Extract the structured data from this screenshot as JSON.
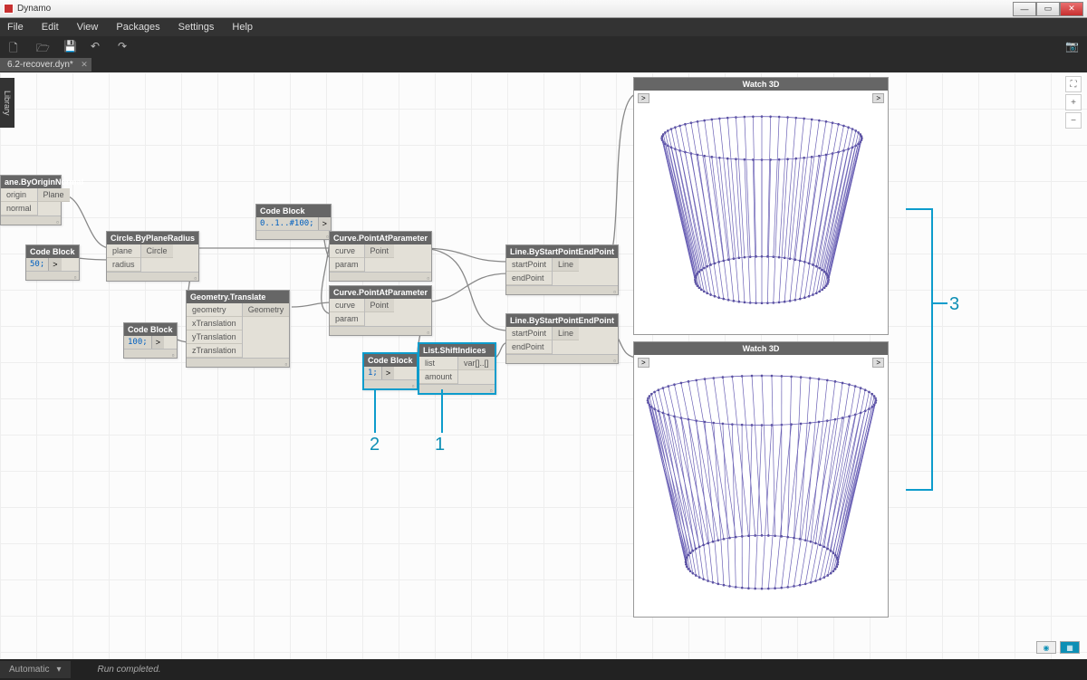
{
  "app_title": "Dynamo",
  "menu": [
    "File",
    "Edit",
    "View",
    "Packages",
    "Settings",
    "Help"
  ],
  "tab_name": "6.2-recover.dyn*",
  "library_label": "Library",
  "run_mode": "Automatic",
  "run_msg": "Run completed.",
  "annotations": {
    "a1": "1",
    "a2": "2",
    "a3": "3"
  },
  "nodes": {
    "planeByOriginNormal": {
      "title": "ane.ByOriginNormal",
      "inputs": [
        "origin",
        "normal"
      ],
      "outputs": [
        "Plane"
      ]
    },
    "codeBlock50": {
      "title": "Code Block",
      "code": "50;",
      "out": ">"
    },
    "codeBlock100": {
      "title": "Code Block",
      "code": "100;",
      "out": ">"
    },
    "codeBlockRange": {
      "title": "Code Block",
      "code": "0..1..#100;",
      "out": ">"
    },
    "codeBlock1": {
      "title": "Code Block",
      "code": "1;",
      "out": ">"
    },
    "circleByPlaneRadius": {
      "title": "Circle.ByPlaneRadius",
      "inputs": [
        "plane",
        "radius"
      ],
      "outputs": [
        "Circle"
      ]
    },
    "geometryTranslate": {
      "title": "Geometry.Translate",
      "inputs": [
        "geometry",
        "xTranslation",
        "yTranslation",
        "zTranslation"
      ],
      "outputs": [
        "Geometry"
      ]
    },
    "curvePointAtParam1": {
      "title": "Curve.PointAtParameter",
      "inputs": [
        "curve",
        "param"
      ],
      "outputs": [
        "Point"
      ]
    },
    "curvePointAtParam2": {
      "title": "Curve.PointAtParameter",
      "inputs": [
        "curve",
        "param"
      ],
      "outputs": [
        "Point"
      ]
    },
    "listShiftIndices": {
      "title": "List.ShiftIndices",
      "inputs": [
        "list",
        "amount"
      ],
      "outputs": [
        "var[]..[]"
      ]
    },
    "lineByStartEnd1": {
      "title": "Line.ByStartPointEndPoint",
      "inputs": [
        "startPoint",
        "endPoint"
      ],
      "outputs": [
        "Line"
      ]
    },
    "lineByStartEnd2": {
      "title": "Line.ByStartPointEndPoint",
      "inputs": [
        "startPoint",
        "endPoint"
      ],
      "outputs": [
        "Line"
      ]
    },
    "watch3d1": {
      "title": "Watch 3D"
    },
    "watch3d2": {
      "title": "Watch 3D"
    }
  }
}
